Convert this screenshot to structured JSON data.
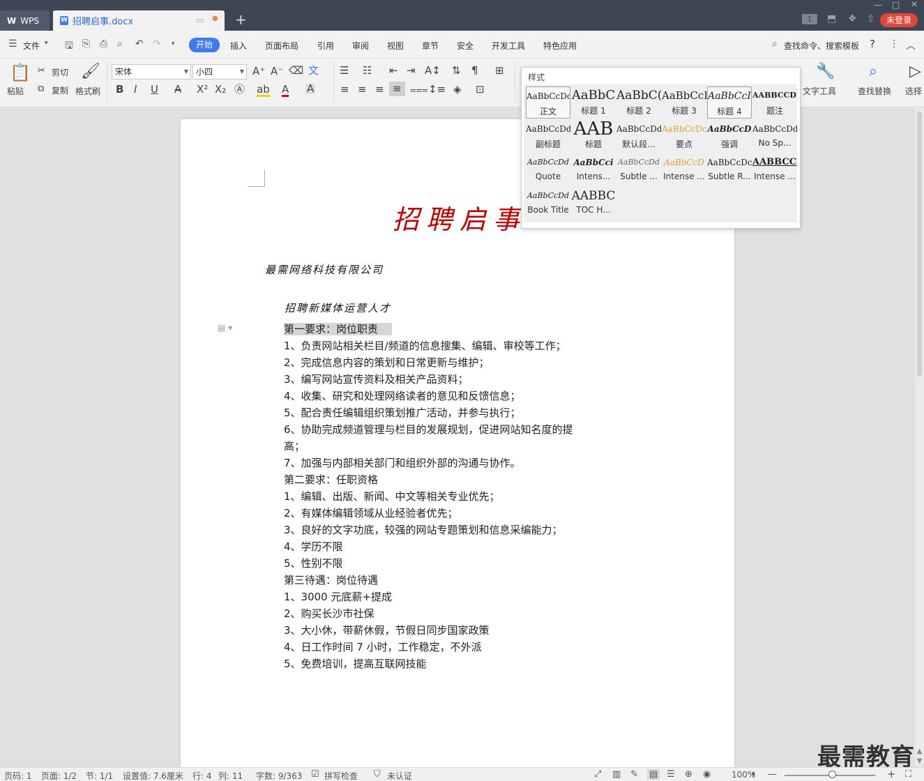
{
  "tabs": {
    "wps_label": "WPS",
    "doc_label": "招聘启事.docx"
  },
  "title_right": {
    "badge": "1",
    "login": "未登录"
  },
  "menu": {
    "file": "文件",
    "items": [
      "开始",
      "插入",
      "页面布局",
      "引用",
      "审阅",
      "视图",
      "章节",
      "安全",
      "开发工具",
      "特色应用"
    ],
    "search": "查找命令、搜索模板",
    "help": "?"
  },
  "ribbon": {
    "paste": "粘贴",
    "cut": "剪切",
    "copy": "复制",
    "format_painter": "格式刷",
    "font_name": "宋体",
    "font_size": "小四",
    "text_tools": "文字工具",
    "find_replace": "查找替换",
    "select": "选择"
  },
  "styles_panel": {
    "title": "样式",
    "styles": [
      {
        "preview": "AaBbCcDd",
        "label": "正文"
      },
      {
        "preview": "AaBbC",
        "label": "标题 1"
      },
      {
        "preview": "AaBbC(",
        "label": "标题 2"
      },
      {
        "preview": "AaBbCcI",
        "label": "标题 3"
      },
      {
        "preview": "AaBbCcI",
        "label": "标题 4"
      },
      {
        "preview": "AABBCCDD",
        "label": "题注"
      },
      {
        "preview": "AaBbCcDd",
        "label": "副标题"
      },
      {
        "preview": "AAB",
        "label": "标题"
      },
      {
        "preview": "AaBbCcDd",
        "label": "默认段..."
      },
      {
        "preview": "AaBbCcDc",
        "label": "要点"
      },
      {
        "preview": "AaBbCcD",
        "label": "强调"
      },
      {
        "preview": "AaBbCcDd",
        "label": "No Sp..."
      },
      {
        "preview": "AaBbCcDd",
        "label": "Quote"
      },
      {
        "preview": "AaBbCci",
        "label": "Intens..."
      },
      {
        "preview": "AaBbCcDd",
        "label": "Subtle ..."
      },
      {
        "preview": "AaBbCcD",
        "label": "Intense ..."
      },
      {
        "preview": "AaBbCcDc",
        "label": "Subtle R..."
      },
      {
        "preview": "AABBCCI",
        "label": "Intense ..."
      },
      {
        "preview": "AaBbCcDd",
        "label": "Book Title"
      },
      {
        "preview": "AABBC",
        "label": "TOC H..."
      }
    ]
  },
  "document": {
    "title": "招聘启事",
    "company": "最需网络科技有限公司",
    "subheading": "招聘新媒体运营人才",
    "lines": [
      "第一要求：岗位职责",
      "1、负责网站相关栏目/频道的信息搜集、编辑、审校等工作；",
      "2、完成信息内容的策划和日常更新与维护；",
      "3、编写网站宣传资料及相关产品资料；",
      "4、收集、研究和处理网络读者的意见和反馈信息；",
      "5、配合责任编辑组织策划推广活动，并参与执行；",
      "6、协助完成频道管理与栏目的发展规划，促进网站知名度的提",
      "高；",
      "7、加强与内部相关部门和组织外部的沟通与协作。",
      "第二要求：任职资格",
      "1、编辑、出版、新闻、中文等相关专业优先；",
      "2、有媒体编辑领域从业经验者优先；",
      "3、良好的文字功底，较强的网站专题策划和信息采编能力；",
      "4、学历不限",
      "5、性别不限",
      "第三待遇：岗位待遇",
      "1、3000 元底薪+提成",
      "2、购买长沙市社保",
      "3、大小休，带薪休假，节假日同步国家政策",
      "4、日工作时间 7 小时，工作稳定，不外派",
      "5、免费培训，提高互联网技能"
    ]
  },
  "status": {
    "page_no": "页码: 1",
    "pages": "页面: 1/2",
    "section": "节: 1/1",
    "setting": "设置值: 7.6厘米",
    "row": "行: 4",
    "col": "列: 11",
    "word_count": "字数: 9/363",
    "spell_check": "拼写检查",
    "auth": "未认证",
    "zoom": "100%"
  },
  "watermark": "最需教育"
}
